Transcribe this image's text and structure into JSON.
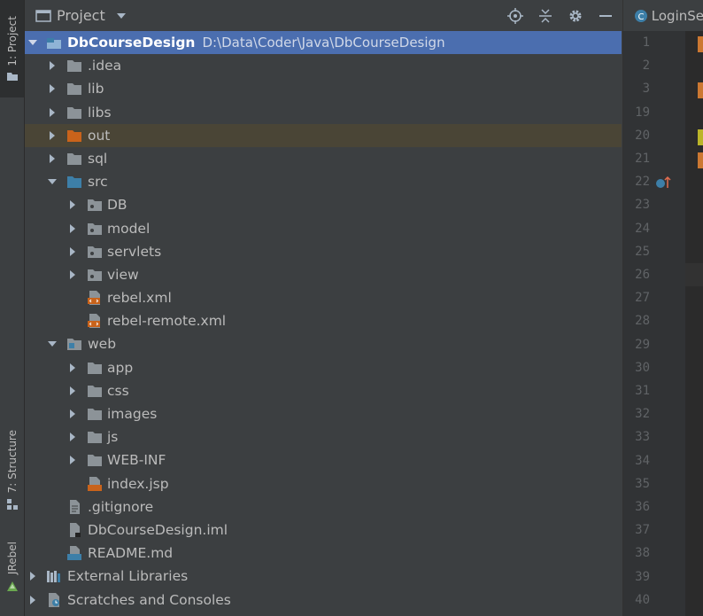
{
  "left_strip": {
    "project_tab": "1: Project",
    "structure_tab": "7: Structure",
    "jrebel_tab": "JRebel"
  },
  "panel": {
    "title": "Project"
  },
  "tree": [
    {
      "label": "DbCourseDesign",
      "path": "D:\\Data\\Coder\\Java\\DbCourseDesign",
      "icon": "module-folder-icon"
    },
    {
      "label": ".idea",
      "icon": "folder-icon"
    },
    {
      "label": "lib",
      "icon": "folder-icon"
    },
    {
      "label": "libs",
      "icon": "folder-icon"
    },
    {
      "label": "out",
      "icon": "excluded-folder-icon"
    },
    {
      "label": "sql",
      "icon": "folder-icon"
    },
    {
      "label": "src",
      "icon": "source-folder-icon"
    },
    {
      "label": "DB",
      "icon": "package-icon"
    },
    {
      "label": "model",
      "icon": "package-icon"
    },
    {
      "label": "servlets",
      "icon": "package-icon"
    },
    {
      "label": "view",
      "icon": "package-icon"
    },
    {
      "label": "rebel.xml",
      "icon": "xml-file-icon"
    },
    {
      "label": "rebel-remote.xml",
      "icon": "xml-file-icon"
    },
    {
      "label": "web",
      "icon": "web-folder-icon"
    },
    {
      "label": "app",
      "icon": "folder-icon"
    },
    {
      "label": "css",
      "icon": "folder-icon"
    },
    {
      "label": "images",
      "icon": "folder-icon"
    },
    {
      "label": "js",
      "icon": "folder-icon"
    },
    {
      "label": "WEB-INF",
      "icon": "folder-icon"
    },
    {
      "label": "index.jsp",
      "icon": "jsp-file-icon"
    },
    {
      "label": ".gitignore",
      "icon": "text-file-icon"
    },
    {
      "label": "DbCourseDesign.iml",
      "icon": "iml-file-icon"
    },
    {
      "label": "README.md",
      "icon": "markdown-file-icon"
    },
    {
      "label": "External Libraries",
      "icon": "libraries-icon"
    },
    {
      "label": "Scratches and Consoles",
      "icon": "scratches-icon"
    }
  ],
  "editor": {
    "tab_title": "LoginSe",
    "line_numbers": [
      "1",
      "2",
      "3",
      "19",
      "20",
      "21",
      "22",
      "23",
      "24",
      "25",
      "26",
      "27",
      "28",
      "29",
      "30",
      "31",
      "32",
      "33",
      "34",
      "35",
      "36",
      "37",
      "38",
      "39",
      "40"
    ]
  },
  "colors": {
    "selection": "#4b6eaf",
    "excluded_highlight": "#4a4536",
    "folder": "#8c9398",
    "excluded_folder": "#c9631b",
    "source_folder": "#3d7fa8"
  }
}
